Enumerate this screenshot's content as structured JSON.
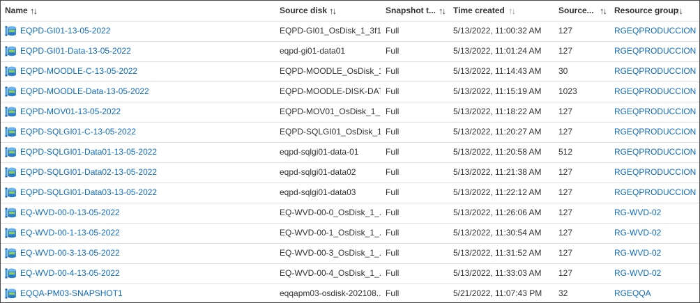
{
  "columns": {
    "name": "Name",
    "source_disk": "Source disk",
    "snapshot_type": "Snapshot t...",
    "time_created": "Time created",
    "source_size": "Source...",
    "resource_group": "Resource group"
  },
  "sort_glyph": "↑↓",
  "rows": [
    {
      "name": "EQPD-GI01-13-05-2022",
      "source_disk": "EQPD-GI01_OsDisk_1_3f1...",
      "type": "Full",
      "time": "5/13/2022, 11:00:32 AM",
      "size": "127",
      "rg": "RGEQPRODUCCION"
    },
    {
      "name": "EQPD-GI01-Data-13-05-2022",
      "source_disk": "eqpd-gi01-data01",
      "type": "Full",
      "time": "5/13/2022, 11:01:24 AM",
      "size": "127",
      "rg": "RGEQPRODUCCION"
    },
    {
      "name": "EQPD-MOODLE-C-13-05-2022",
      "source_disk": "EQPD-MOODLE_OsDisk_1...",
      "type": "Full",
      "time": "5/13/2022, 11:14:43 AM",
      "size": "30",
      "rg": "RGEQPRODUCCION"
    },
    {
      "name": "EQPD-MOODLE-Data-13-05-2022",
      "source_disk": "EQPD-MOODLE-DISK-DATA",
      "type": "Full",
      "time": "5/13/2022, 11:15:19 AM",
      "size": "1023",
      "rg": "RGEQPRODUCCION"
    },
    {
      "name": "EQPD-MOV01-13-05-2022",
      "source_disk": "EQPD-MOV01_OsDisk_1_...",
      "type": "Full",
      "time": "5/13/2022, 11:18:22 AM",
      "size": "127",
      "rg": "RGEQPRODUCCION"
    },
    {
      "name": "EQPD-SQLGI01-C-13-05-2022",
      "source_disk": "EQPD-SQLGI01_OsDisk_1_...",
      "type": "Full",
      "time": "5/13/2022, 11:20:27 AM",
      "size": "127",
      "rg": "RGEQPRODUCCION"
    },
    {
      "name": "EQPD-SQLGI01-Data01-13-05-2022",
      "source_disk": "eqpd-sqlgi01-data-01",
      "type": "Full",
      "time": "5/13/2022, 11:20:58 AM",
      "size": "512",
      "rg": "RGEQPRODUCCION"
    },
    {
      "name": "EQPD-SQLGI01-Data02-13-05-2022",
      "source_disk": "eqpd-sqlgi01-data02",
      "type": "Full",
      "time": "5/13/2022, 11:21:38 AM",
      "size": "127",
      "rg": "RGEQPRODUCCION"
    },
    {
      "name": "EQPD-SQLGI01-Data03-13-05-2022",
      "source_disk": "eqpd-sqlgi01-data03",
      "type": "Full",
      "time": "5/13/2022, 11:22:12 AM",
      "size": "127",
      "rg": "RGEQPRODUCCION"
    },
    {
      "name": "EQ-WVD-00-0-13-05-2022",
      "source_disk": "EQ-WVD-00-0_OsDisk_1_...",
      "type": "Full",
      "time": "5/13/2022, 11:26:06 AM",
      "size": "127",
      "rg": "RG-WVD-02"
    },
    {
      "name": "EQ-WVD-00-1-13-05-2022",
      "source_disk": "EQ-WVD-00-1_OsDisk_1_...",
      "type": "Full",
      "time": "5/13/2022, 11:30:54 AM",
      "size": "127",
      "rg": "RG-WVD-02"
    },
    {
      "name": "EQ-WVD-00-3-13-05-2022",
      "source_disk": "EQ-WVD-00-3_OsDisk_1_...",
      "type": "Full",
      "time": "5/13/2022, 11:31:52 AM",
      "size": "127",
      "rg": "RG-WVD-02"
    },
    {
      "name": "EQ-WVD-00-4-13-05-2022",
      "source_disk": "EQ-WVD-00-4_OsDisk_1_...",
      "type": "Full",
      "time": "5/13/2022, 11:33:03 AM",
      "size": "127",
      "rg": "RG-WVD-02"
    },
    {
      "name": "EQQA-PM03-SNAPSHOT1",
      "source_disk": "eqqapm03-osdisk-202108...",
      "type": "Full",
      "time": "5/21/2022, 11:07:43 PM",
      "size": "32",
      "rg": "RGEQQA"
    }
  ],
  "icon": "snapshot-icon",
  "colors": {
    "link": "#0f6cbd",
    "text": "#323130",
    "divider": "#e1dfdd",
    "border": "#4a4a4a"
  }
}
